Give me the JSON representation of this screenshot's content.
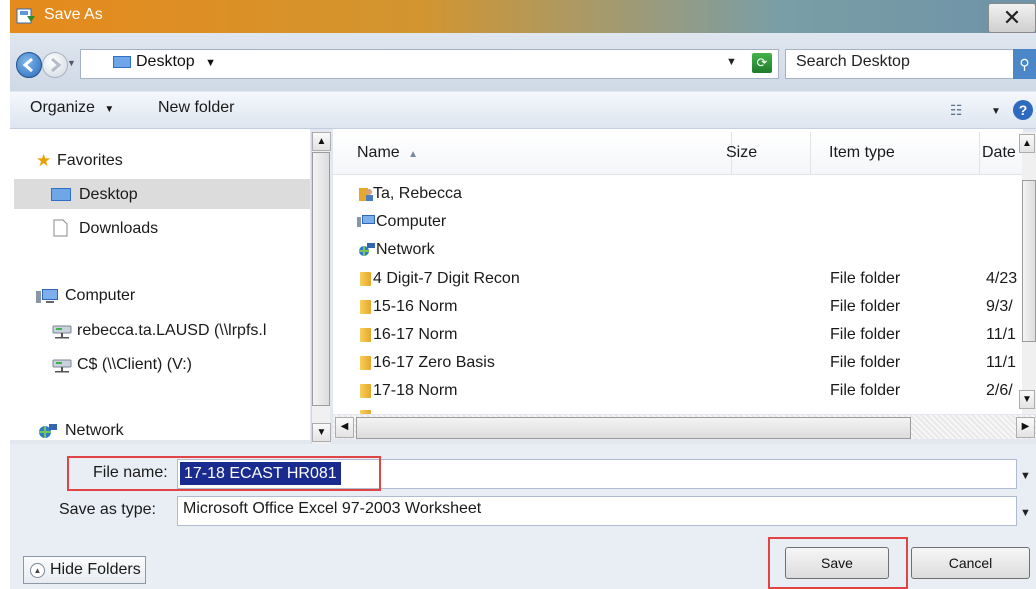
{
  "window": {
    "title": "Save As",
    "close_glyph": "✕"
  },
  "address": {
    "location": "Desktop",
    "search_placeholder": "Search Desktop"
  },
  "toolbar": {
    "organize": "Organize",
    "new_folder": "New folder"
  },
  "nav": {
    "favorites": "Favorites",
    "desktop": "Desktop",
    "downloads": "Downloads",
    "computer": "Computer",
    "drive1": "rebecca.ta.LAUSD (\\\\lrpfs.l",
    "drive2": "C$ (\\\\Client) (V:)",
    "network": "Network"
  },
  "columns": {
    "name": "Name",
    "size": "Size",
    "type": "Item type",
    "date": "Date"
  },
  "files": [
    {
      "name": "Ta, Rebecca",
      "type": "",
      "date": ""
    },
    {
      "name": "Computer",
      "type": "",
      "date": ""
    },
    {
      "name": "Network",
      "type": "",
      "date": ""
    },
    {
      "name": "4 Digit-7 Digit Recon",
      "type": "File folder",
      "date": "4/23"
    },
    {
      "name": "15-16 Norm",
      "type": "File folder",
      "date": "9/3/"
    },
    {
      "name": "16-17 Norm",
      "type": "File folder",
      "date": "11/1"
    },
    {
      "name": "16-17 Zero Basis",
      "type": "File folder",
      "date": "11/1"
    },
    {
      "name": "17-18 Norm",
      "type": "File folder",
      "date": "2/6/"
    }
  ],
  "form": {
    "filename_label": "File name:",
    "filename_value": "17-18 ECAST HR081",
    "type_label": "Save as type:",
    "type_value": "Microsoft Office Excel 97-2003 Worksheet"
  },
  "buttons": {
    "hide_folders": "Hide Folders",
    "save": "Save",
    "cancel": "Cancel"
  },
  "colors": {
    "highlight": "#1a2b90",
    "annotation": "#e04444",
    "title_bar": "#e68a1c"
  }
}
